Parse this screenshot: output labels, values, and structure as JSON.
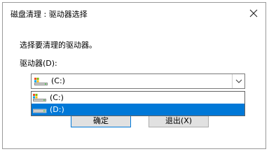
{
  "dialog": {
    "title": "磁盘清理 : 驱动器选择",
    "prompt": "选择要清理的驱动器。",
    "drive_label": "驱动器(D):",
    "selected_drive": "(C:)",
    "drives": [
      {
        "label": "(C:)",
        "icon": "system-drive-icon"
      },
      {
        "label": "(D:)",
        "icon": "local-drive-icon"
      }
    ],
    "highlighted_index": 1,
    "ok_label": "确定",
    "exit_label": "退出(X)"
  },
  "colors": {
    "highlight": "#0078d7",
    "button_face": "#e1e1e1",
    "window_border": "#9a9a9a"
  }
}
